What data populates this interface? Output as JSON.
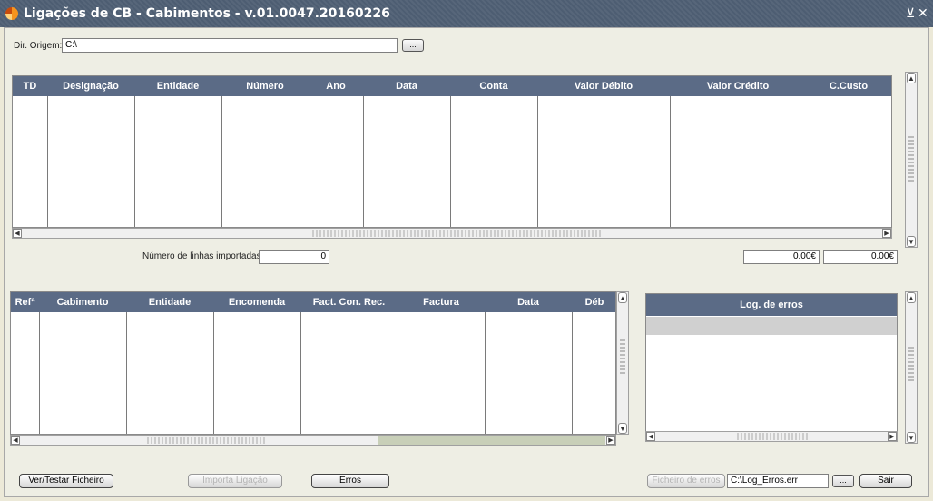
{
  "window": {
    "title": "Ligações de CB - Cabimentos - v.01.0047.20160226",
    "controls": [
      "⊻",
      "✕"
    ]
  },
  "origin": {
    "label": "Dir. Origem:",
    "value": "C:\\",
    "browse_label": "..."
  },
  "top_grid": {
    "columns": [
      "TD",
      "Designação",
      "Entidade",
      "Número",
      "Ano",
      "Data",
      "Conta",
      "Valor Débito",
      "Valor Crédito",
      "C.Custo"
    ],
    "rows": []
  },
  "imported": {
    "label": "Número de linhas importadas:",
    "value": "0"
  },
  "totals": {
    "debit": "0.00€",
    "credit": "0.00€"
  },
  "bottom_grid": {
    "columns": [
      "Refª",
      "Cabimento",
      "Entidade",
      "Encomenda",
      "Fact. Con. Rec.",
      "Factura",
      "Data",
      "Déb"
    ],
    "rows": []
  },
  "log": {
    "header": "Log. de erros",
    "entries": []
  },
  "buttons": {
    "ver_testar": "Ver/Testar Ficheiro",
    "importa": "Importa Ligação",
    "erros": "Erros",
    "ficheiro_erros": "Ficheiro de erros",
    "ficheiro_erros_value": "C:\\Log_Erros.err",
    "ficheiro_browse": "...",
    "sair": "Sair"
  },
  "colors": {
    "title_bar": "#4d5d72",
    "grid_header": "#5b6b86",
    "background": "#eeeee4"
  }
}
